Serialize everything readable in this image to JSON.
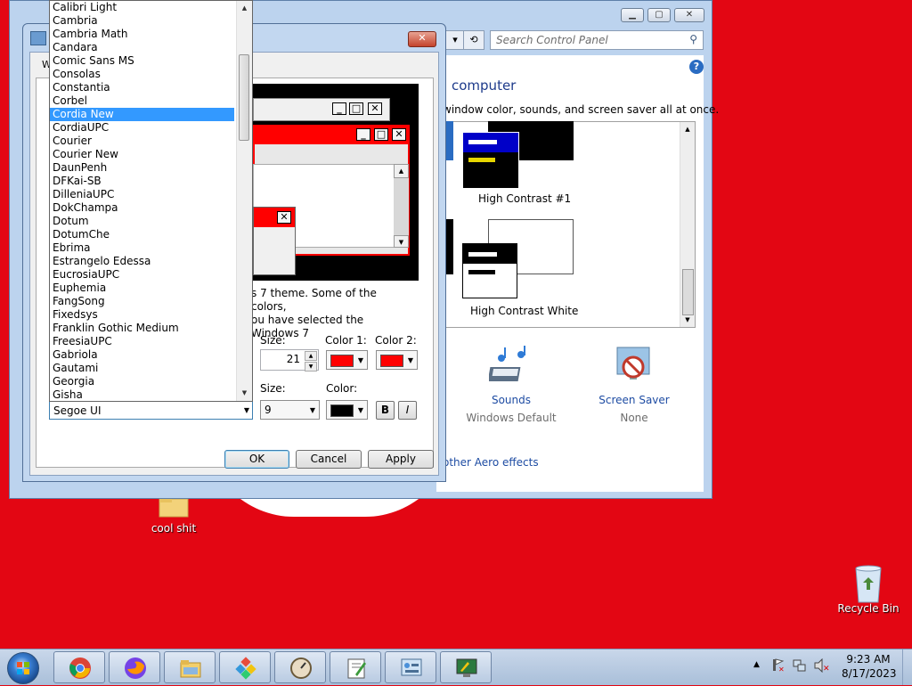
{
  "desktop": {
    "icons": [
      {
        "label": "cool shit"
      },
      {
        "label": "Recycle Bin"
      }
    ]
  },
  "control_panel": {
    "search_placeholder": "Search Control Panel",
    "heading": "computer",
    "subtext": "window color, sounds, and screen saver all at once.",
    "themes": [
      {
        "label": "High Contrast #1"
      },
      {
        "label": "High Contrast White"
      }
    ],
    "sounds": {
      "label": "Sounds",
      "value": "Windows Default"
    },
    "screen_saver": {
      "label": "Screen Saver",
      "value": "None"
    },
    "aero_link": "other Aero effects",
    "help_glyph": "?"
  },
  "dialog": {
    "tab_stub": "W",
    "description_line1": "s 7 theme.  Some of the colors,",
    "description_line2": "ou have selected the Windows 7",
    "item_row": {
      "size_label": "Size:",
      "size_value": "21",
      "color1_label": "Color 1:",
      "color1_value": "#ff0000",
      "color2_label": "Color 2:",
      "color2_value": "#ff0000"
    },
    "font_row": {
      "font_value": "Segoe UI",
      "size_label": "Size:",
      "size_value": "9",
      "color_label": "Color:",
      "color_value": "#000000",
      "bold_label": "B",
      "italic_label": "I"
    },
    "buttons": {
      "ok": "OK",
      "cancel": "Cancel",
      "apply": "Apply"
    }
  },
  "font_list": {
    "items": [
      "Calibri Light",
      "Cambria",
      "Cambria Math",
      "Candara",
      "Comic Sans MS",
      "Consolas",
      "Constantia",
      "Corbel",
      "Cordia New",
      "CordiaUPC",
      "Courier",
      "Courier New",
      "DaunPenh",
      "DFKai-SB",
      "DilleniaUPC",
      "DokChampa",
      "Dotum",
      "DotumChe",
      "Ebrima",
      "Estrangelo Edessa",
      "EucrosiaUPC",
      "Euphemia",
      "FangSong",
      "Fixedsys",
      "Franklin Gothic Medium",
      "FreesiaUPC",
      "Gabriola",
      "Gautami",
      "Georgia",
      "Gisha"
    ],
    "selected": "Cordia New"
  },
  "taskbar": {
    "apps": [
      "chrome-icon",
      "firefox-icon",
      "explorer-icon",
      "app-icon",
      "dial-icon",
      "editor-icon",
      "control-panel-icon",
      "personalization-icon"
    ],
    "time": "9:23 AM",
    "date": "8/17/2023"
  },
  "colors": {
    "desktop_bg": "#e30613",
    "selection": "#3399ff",
    "link": "#1e4ca3"
  }
}
